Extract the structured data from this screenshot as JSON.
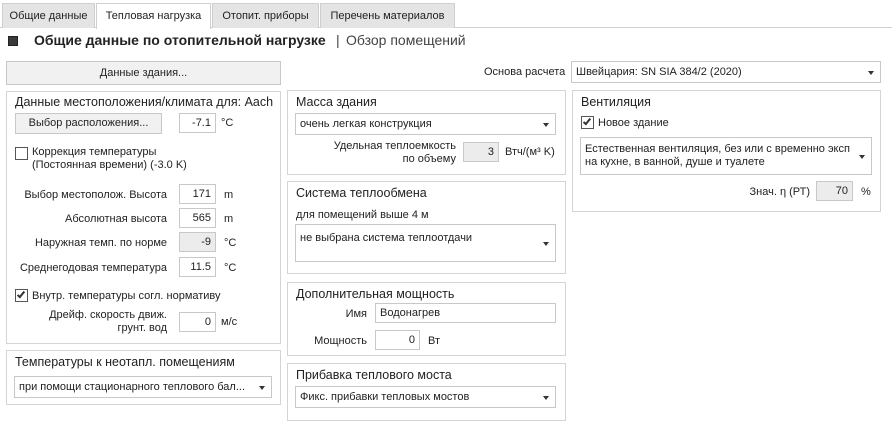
{
  "tabs": [
    {
      "label": "Общие данные"
    },
    {
      "label": "Тепловая нагрузка"
    },
    {
      "label": "Отопит. приборы"
    },
    {
      "label": "Перечень материалов"
    }
  ],
  "header": {
    "title": "Общие данные по отопительной нагрузке",
    "separator": "|",
    "subtitle": "Обзор помещений"
  },
  "building_data_button": "Данные здания...",
  "calc_basis": {
    "label": "Основа расчета",
    "value": "Швейцария: SN SIA 384/2 (2020)"
  },
  "location": {
    "title": "Данные местоположения/климата для: Aach",
    "select_button": "Выбор расположения...",
    "select_value": "-7.1",
    "select_unit": "°C",
    "temp_correction_label_1": "Коррекция температуры",
    "temp_correction_label_2": "(Постоянная времени) (-3.0 K)",
    "temp_correction_checked": false,
    "site_height_label": "Выбор местополож. Высота",
    "site_height_value": "171",
    "site_height_unit": "m",
    "abs_height_label": "Абсолютная высота",
    "abs_height_value": "565",
    "abs_height_unit": "m",
    "outdoor_temp_label": "Наружная темп. по норме",
    "outdoor_temp_value": "-9",
    "outdoor_temp_unit": "°C",
    "annual_temp_label": "Среднегодовая температура",
    "annual_temp_value": "11.5",
    "annual_temp_unit": "°C",
    "internal_temp_label": "Внутр. температуры согл. нормативу",
    "internal_temp_checked": true,
    "drift_label_1": "Дрейф. скорость движ.",
    "drift_label_2": "грунт. вод",
    "drift_value": "0",
    "drift_unit": "м/с"
  },
  "unheated": {
    "title": "Температуры к неотапл. помещениям",
    "value": "при помощи стационарного теплового бал..."
  },
  "mass": {
    "title": "Масса здания",
    "value": "очень легкая конструкция",
    "capacity_label_1": "Удельная теплоемкость",
    "capacity_label_2": "по объему",
    "capacity_value": "3",
    "capacity_unit": "Втч/(м³ K)"
  },
  "heat_exchange": {
    "title": "Система теплообмена",
    "subtitle": "для помещений выше 4 м",
    "value": "не выбрана система теплоотдачи"
  },
  "extra_power": {
    "title": "Дополнительная мощность",
    "name_label": "Имя",
    "name_value": "Водонагрев",
    "power_label": "Мощность",
    "power_value": "0",
    "power_unit": "Вт"
  },
  "thermal_bridge": {
    "title": "Прибавка теплового моста",
    "value": "Фикс. прибавки тепловых мостов"
  },
  "ventilation": {
    "title": "Вентиляция",
    "new_building_label": "Новое здание",
    "new_building_checked": true,
    "value_1": "Естественная вентиляция, без или с временно эксп",
    "value_2": "на кухне, в ванной, душе и туалете",
    "eta_label": "Знач. η (РТ)",
    "eta_value": "70",
    "eta_unit": "%"
  }
}
